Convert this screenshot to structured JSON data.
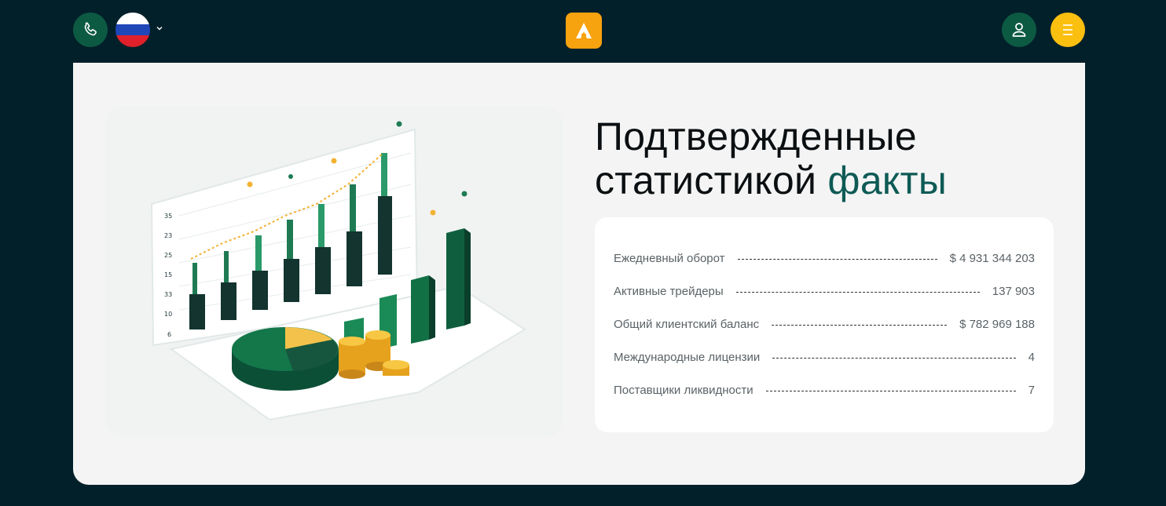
{
  "header": {
    "phone_icon": "phone-icon",
    "language_flag": "russia-flag",
    "logo_icon": "brand-logo-a",
    "user_icon": "user-icon",
    "menu_icon": "hamburger-icon"
  },
  "colors": {
    "background": "#02202a",
    "brand_orange": "#f7a20f",
    "brand_yellow": "#fbbf10",
    "brand_green": "#0d5a43",
    "accent_text": "#0e5a55"
  },
  "section": {
    "title_line1": "Подтвержденные",
    "title_line2_prefix": "статистикой ",
    "title_accent": "факты",
    "stats": [
      {
        "label": "Ежедневный оборот",
        "value": "$ 4 931 344 203"
      },
      {
        "label": "Активные трейдеры",
        "value": "137 903"
      },
      {
        "label": "Общий клиентский баланс",
        "value": "$ 782 969 188"
      },
      {
        "label": "Международные лицензии",
        "value": "4"
      },
      {
        "label": "Поставщики ликвидности",
        "value": "7"
      }
    ]
  },
  "illustration": {
    "y_tick_labels": [
      "35",
      "23",
      "25",
      "15",
      "33",
      "10",
      "6"
    ]
  }
}
